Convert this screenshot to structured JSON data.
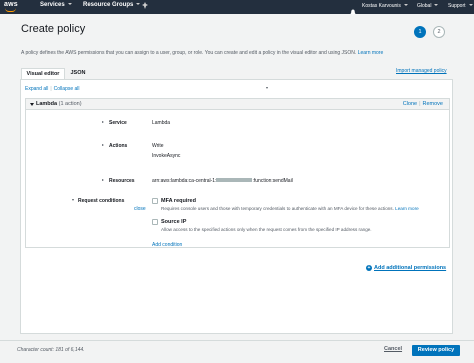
{
  "topnav": {
    "logo_text": "aws",
    "services": "Services",
    "resource_groups": "Resource Groups",
    "account": "Kostas Karvounis",
    "region": "Global",
    "support": "Support",
    "accent_color": "#ff9900"
  },
  "page": {
    "title": "Create policy",
    "step_active": "1",
    "step_next": "2",
    "description": "A policy defines the AWS permissions that you can assign to a user, group, or role. You can create and edit a policy in the visual editor and using JSON.",
    "learn_more": "Learn more"
  },
  "tabs": {
    "visual_editor": "Visual editor",
    "json": "JSON",
    "import_link": "Import managed policy"
  },
  "editor": {
    "expand_all": "Expand all",
    "collapse_all": "Collapse all",
    "service_block": {
      "name": "Lambda",
      "count": "(1 action)",
      "clone": "Clone",
      "remove": "Remove",
      "service_label": "Service",
      "service_value": "Lambda",
      "actions_label": "Actions",
      "actions_value": "Write",
      "actions_item": "InvokeAsync",
      "resources_label": "Resources",
      "resources_prefix": "arn:aws:lambda:ca-central-1:",
      "resources_suffix": ":function:sendMail",
      "conditions_label": "Request conditions",
      "conditions_close": "close",
      "mfa_title": "MFA required",
      "mfa_desc": "Requires console users and those with temporary credentials to authenticate with an MFA device for these actions.",
      "mfa_learn_more": "Learn more",
      "sourceip_title": "Source IP",
      "sourceip_desc": "Allow access to the specified actions only when the request comes from the specified IP address range.",
      "add_condition": "Add condition"
    },
    "add_permissions": "Add additional permissions"
  },
  "footer": {
    "char_count": "Character count: 181 of 6,144.",
    "cancel": "Cancel",
    "review": "Review policy"
  }
}
